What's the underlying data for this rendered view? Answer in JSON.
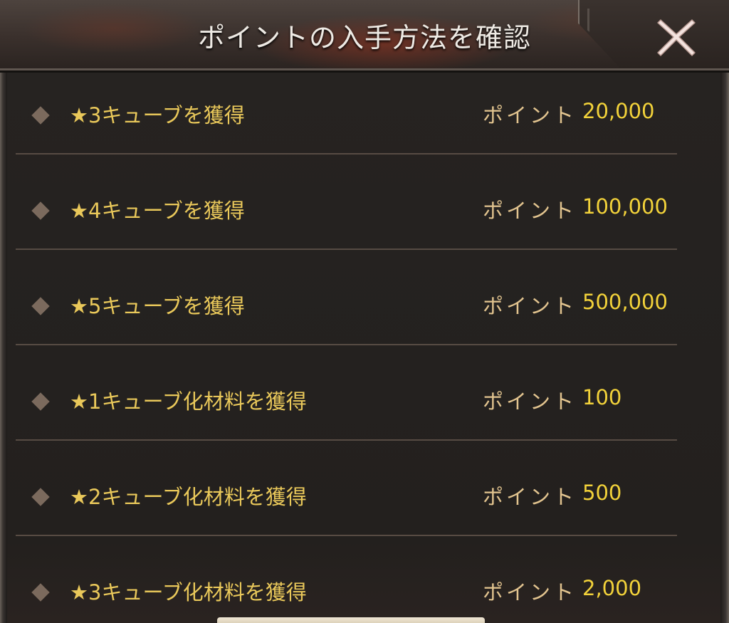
{
  "header": {
    "title": "ポイントの入手方法を確認",
    "close_icon": "close-x-icon"
  },
  "rows": [
    {
      "label": "★3キューブを獲得",
      "points_label": "ポイント",
      "points_value": "20,000"
    },
    {
      "label": "★4キューブを獲得",
      "points_label": "ポイント",
      "points_value": "100,000"
    },
    {
      "label": "★5キューブを獲得",
      "points_label": "ポイント",
      "points_value": "500,000"
    },
    {
      "label": "★1キューブ化材料を獲得",
      "points_label": "ポイント",
      "points_value": "100"
    },
    {
      "label": "★2キューブ化材料を獲得",
      "points_label": "ポイント",
      "points_value": "500"
    },
    {
      "label": "★3キューブ化材料を獲得",
      "points_label": "ポイント",
      "points_value": "2,000"
    }
  ],
  "colors": {
    "label": "#e9c85a",
    "points_label": "#e2c48f",
    "points_value": "#f2d23a",
    "bullet": "#7b6a5d",
    "divider": "#574b43"
  }
}
